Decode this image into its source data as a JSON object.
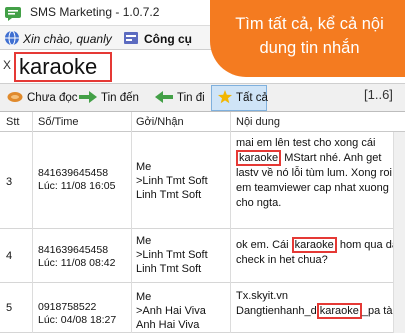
{
  "window": {
    "title": "SMS Marketing - 1.0.7.2"
  },
  "menu": {
    "greeting": "Xin chào, quanly",
    "tools_label": "Công cụ"
  },
  "search": {
    "value": "karaoke",
    "close_label": "X"
  },
  "callout": {
    "text": "Tìm tất cả, kể cả nội dung tin nhắn"
  },
  "filters": [
    {
      "label": "Chưa đọc",
      "icon": "unread-icon"
    },
    {
      "label": "Tin đến",
      "icon": "inbox-arrow-icon"
    },
    {
      "label": "Tin đi",
      "icon": "sent-arrow-icon"
    },
    {
      "label": "Tất cả",
      "icon": "star-icon",
      "selected": true
    }
  ],
  "pagination": {
    "text": "[1..6]"
  },
  "table": {
    "headers": [
      "Stt",
      "Số/Time",
      "Gởi/Nhận",
      "Nội dung"
    ],
    "rows": [
      {
        "stt": "3",
        "sotime": "841639645458\nLúc: 11/08 16:05",
        "goinhan": "Me\n>Linh Tmt Soft\nLinh Tmt Soft",
        "content_before": "mai em lên test cho xong cái ",
        "keyword": "karaoke",
        "content_after": " MStart nhé. Anh get lastv về nó lỗi tùm lum. Xong roi em teamviewer cap nhat xuong cho ngta."
      },
      {
        "stt": "4",
        "sotime": "841639645458\nLúc: 11/08 08:42",
        "goinhan": "Me\n>Linh Tmt Soft\nLinh Tmt Soft",
        "content_before": "ok em. Cái ",
        "keyword": "karaoke",
        "content_after": " hom qua da check in het chua?"
      },
      {
        "stt": "5",
        "sotime": "0918758522\nLúc: 04/08 18:27",
        "goinhan": "Me\n>Anh Hai Viva\nAnh Hai Viva",
        "content_before": "Tx.skyit.vn Dangtienhanh_d",
        "keyword": "karaoke",
        "content_after": "_pa tàu"
      }
    ]
  },
  "colors": {
    "callout": "#f47b20",
    "highlight_border": "#e53935",
    "selected_filter": "#cfe4f7"
  }
}
